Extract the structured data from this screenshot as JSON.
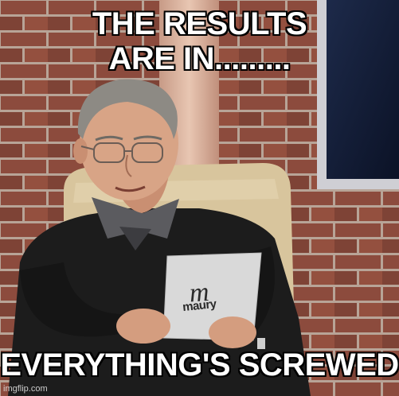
{
  "captions": {
    "top_line_1": "THE RESULTS",
    "top_line_2": "ARE IN.........",
    "bottom": "EVERYTHING'S SCREWED"
  },
  "card": {
    "brand": "maury"
  },
  "watermark": "imgflip.com",
  "colors": {
    "brick": "#8a4a3c",
    "mortar": "#b9a79a",
    "chair": "#d9c7a0",
    "sweater": "#1d1d1d",
    "skin": "#d9a585",
    "card": "#d6d6d6",
    "caption": "#ffffff"
  }
}
